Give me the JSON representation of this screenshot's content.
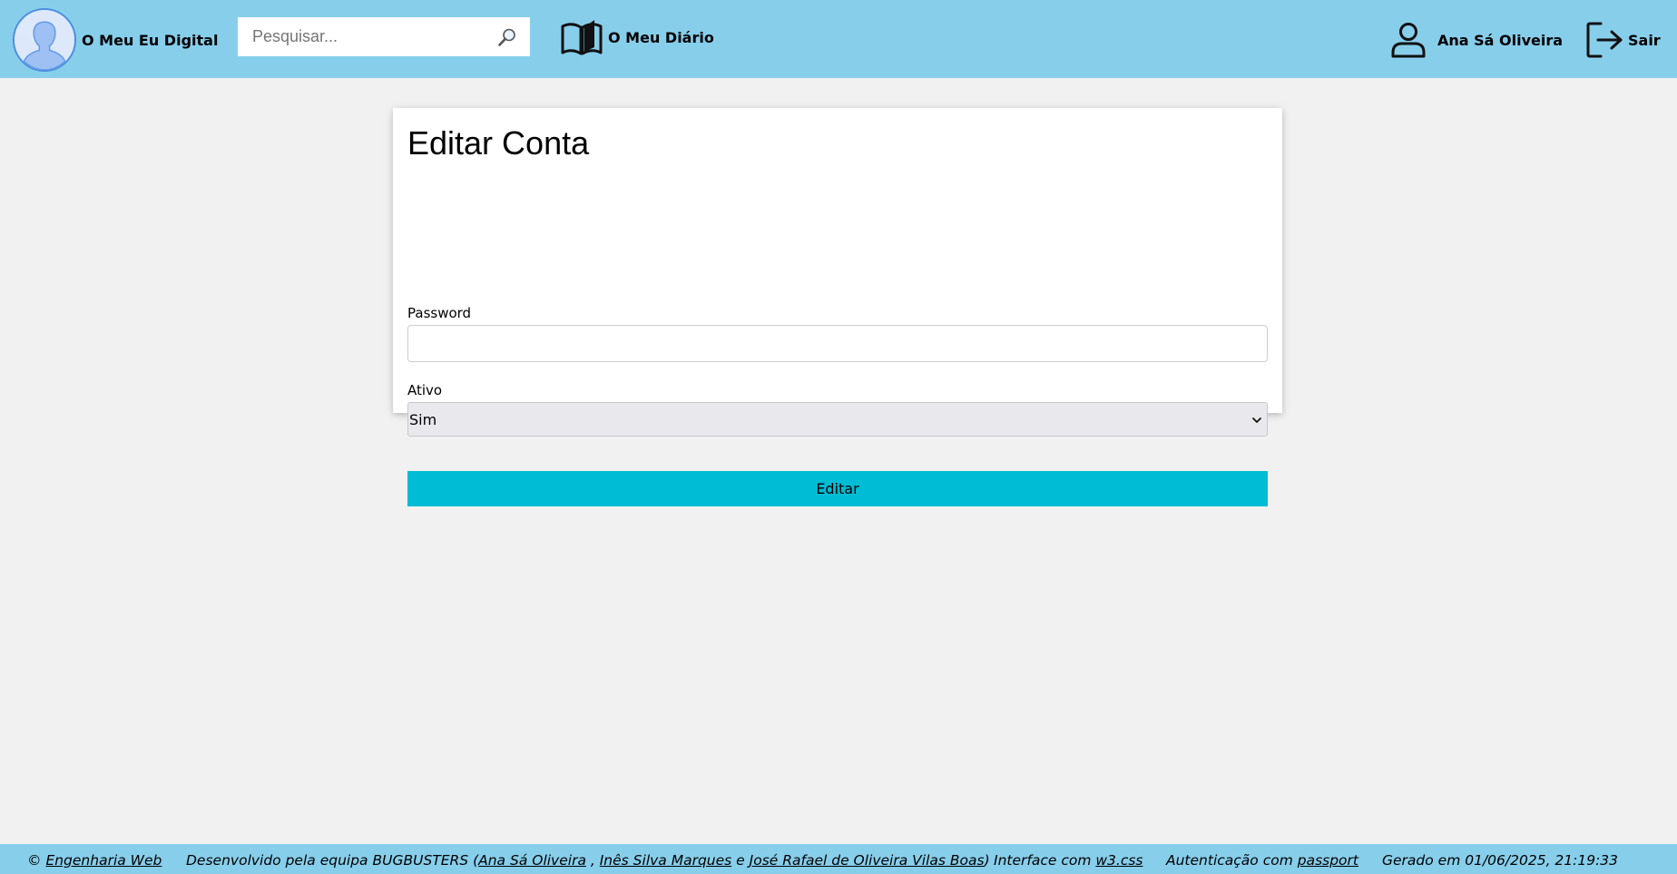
{
  "header": {
    "brand": "O Meu Eu Digital",
    "search_placeholder": "Pesquisar...",
    "diary": "O Meu Diário",
    "user_name": "Ana Sá Oliveira",
    "logout": "Sair"
  },
  "form": {
    "title": "Editar Conta",
    "password_label": "Password",
    "password_value": "",
    "ativo_label": "Ativo",
    "ativo_selected": "Sim",
    "submit_label": "Editar"
  },
  "footer": {
    "copyright_symbol": "©",
    "course_link": "Engenharia Web",
    "dev_prefix": "Desenvolvido pela equipa BUGBUSTERS (",
    "member1": "Ana Sá Oliveira",
    "sep1": " , ",
    "member2": "Inês Silva Marques",
    "sep2": " e ",
    "member3": "José Rafael de Oliveira Vilas Boas",
    "dev_suffix": ")",
    "interface_prefix": "Interface com ",
    "interface_link": "w3.css",
    "auth_prefix": "Autenticação com ",
    "auth_link": "passport",
    "generated": "Gerado em 01/06/2025, 21:19:33"
  },
  "colors": {
    "topbar": "#87ceeb",
    "button": "#00bcd4",
    "background": "#f1f1f1"
  }
}
